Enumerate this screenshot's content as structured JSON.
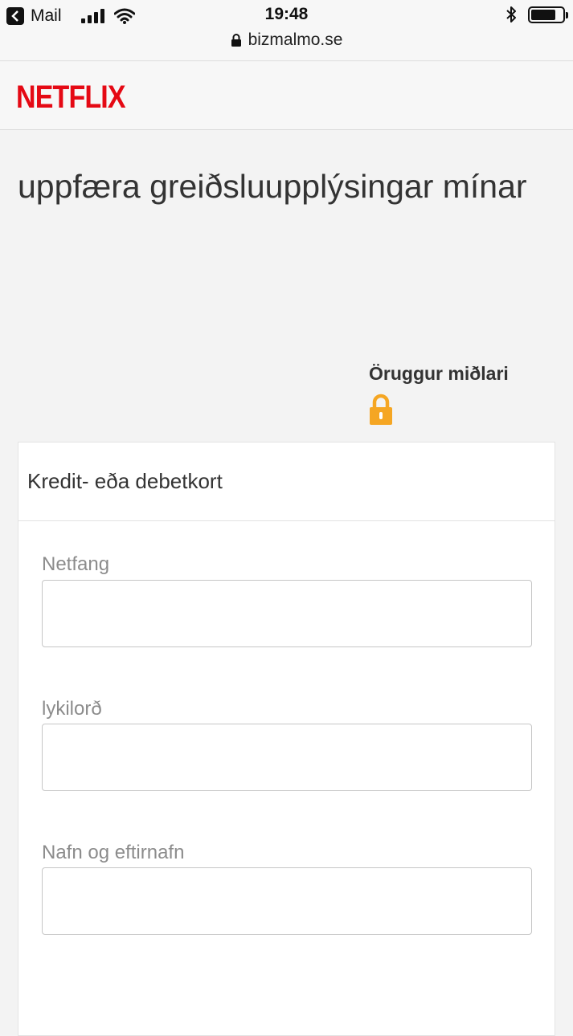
{
  "status_bar": {
    "back_app": "Mail",
    "time": "19:48",
    "url": "bizmalmo.se"
  },
  "header": {
    "logo_text": "NETFLIX",
    "brand_color": "#e50914"
  },
  "page": {
    "title": "uppfæra greiðsluupplýsingar mínar",
    "secure_label": "Öruggur miðlari",
    "lock_color": "#f5a623"
  },
  "card": {
    "header": "Kredit- eða debetkort",
    "fields": [
      {
        "label": "Netfang",
        "value": ""
      },
      {
        "label": "lykilorð",
        "value": ""
      },
      {
        "label": "Nafn og eftirnafn",
        "value": ""
      }
    ]
  }
}
